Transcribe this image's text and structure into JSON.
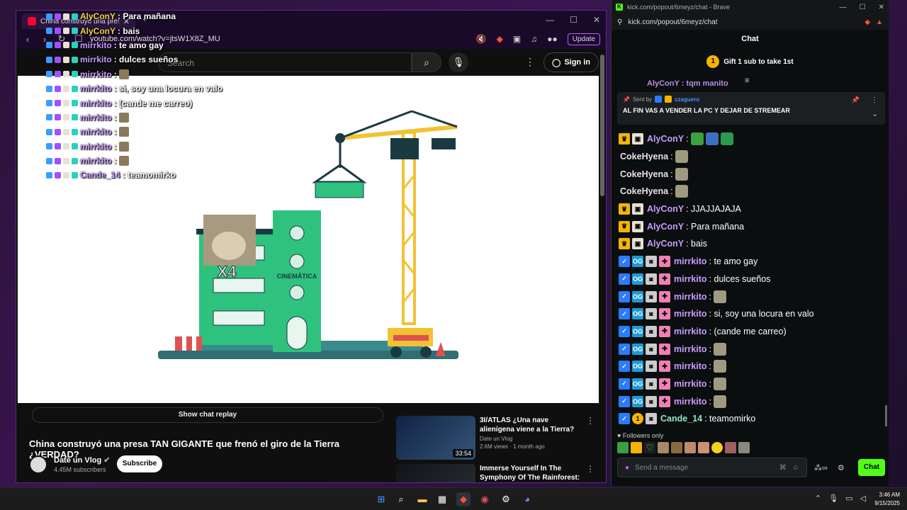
{
  "yt_browser": {
    "tab_title": "China construyó una presa T...",
    "url": "youtube.com/watch?v=jtsW1X8Z_MU",
    "update_label": "Update",
    "search_placeholder": "Search",
    "signin_label": "Sign in"
  },
  "overlay_chat": [
    {
      "user": "AlyConY",
      "text": ": Para mañana",
      "color": "#f5d44a"
    },
    {
      "user": "AlyConY",
      "text": ": bais",
      "color": "#f5d44a"
    },
    {
      "user": "mirrkito",
      "text": ": te amo gay",
      "color": "#ffffff"
    },
    {
      "user": "mirrkito",
      "text": ": dulces sueños",
      "color": "#ffffff"
    },
    {
      "user": "mirrkito",
      "text": ":",
      "color": "#ffffff"
    },
    {
      "user": "mirrkito",
      "text": ": si, soy una locura en valo",
      "color": "#ffffff"
    },
    {
      "user": "mirrkito",
      "text": ": (cande me carreo)",
      "color": "#ffffff"
    },
    {
      "user": "mirrkito",
      "text": ":",
      "color": "#ffffff"
    },
    {
      "user": "mirrkito",
      "text": ":",
      "color": "#ffffff"
    },
    {
      "user": "mirrkito",
      "text": ":",
      "color": "#ffffff"
    },
    {
      "user": "mirrkito",
      "text": ":",
      "color": "#ffffff"
    },
    {
      "user": "Cande_14",
      "text": ": teamomirko",
      "color": "#ffffff"
    }
  ],
  "video": {
    "building_label": "CINEMÁTICA",
    "overlay_label": "X4",
    "replay_label": "Show chat replay",
    "title": "China construyó una presa TAN GIGANTE que frenó el giro de la Tierra ¿VERDAD?",
    "channel": "Date un Vlog",
    "subscribers": "4.45M subscribers",
    "subscribe_label": "Subscribe"
  },
  "recommendations": [
    {
      "title": "3I/ATLAS ¿Una nave alienígena viene a la Tierra?",
      "channel": "Date un Vlog",
      "meta": "2.6M views · 1 month ago",
      "duration": "33:54"
    },
    {
      "title": "Immerse Yourself In The Symphony Of The Rainforest: ...",
      "channel": "",
      "meta": "",
      "duration": ""
    }
  ],
  "kick_browser": {
    "window_title": "kick.com/popout/6meyz/chat - Brave",
    "url": "kick.com/popout/6meyz/chat",
    "header": "Chat",
    "gift_label": "Gift 1 sub to take 1st",
    "gift_count": "1",
    "partial_line": "AlyConY : tqm manito"
  },
  "pinned": {
    "sent_by": "Sent by",
    "user": "czaguero",
    "message": "AL FIN VAS A VENDER LA PC Y DEJAR DE STREMEAR"
  },
  "chat": [
    {
      "user": "AlyConY",
      "color": "#c99cff",
      "text": ":",
      "badges": [
        "crown",
        "sub"
      ],
      "emotes": 3
    },
    {
      "user": "CokeHyena",
      "color": "#e8e0e8",
      "text": ":",
      "badges": [],
      "emotes": 1
    },
    {
      "user": "CokeHyena",
      "color": "#e8e0e8",
      "text": ":",
      "badges": [],
      "emotes": 1
    },
    {
      "user": "CokeHyena",
      "color": "#e8e0e8",
      "text": ":",
      "badges": [],
      "emotes": 1
    },
    {
      "user": "AlyConY",
      "color": "#c99cff",
      "text": ": JJAJJAJAJA",
      "badges": [
        "crown",
        "sub"
      ],
      "emotes": 0
    },
    {
      "user": "AlyConY",
      "color": "#c99cff",
      "text": ": Para mañana",
      "badges": [
        "crown",
        "sub"
      ],
      "emotes": 0
    },
    {
      "user": "AlyConY",
      "color": "#c99cff",
      "text": ": bais",
      "badges": [
        "crown",
        "sub"
      ],
      "emotes": 0
    },
    {
      "user": "mirrkito",
      "color": "#c99cff",
      "text": ": te amo gay",
      "badges": [
        "verified",
        "og",
        "cup",
        "gift"
      ],
      "emotes": 0
    },
    {
      "user": "mirrkito",
      "color": "#c99cff",
      "text": ": dulces sueños",
      "badges": [
        "verified",
        "og",
        "cup",
        "gift"
      ],
      "emotes": 0
    },
    {
      "user": "mirrkito",
      "color": "#c99cff",
      "text": ":",
      "badges": [
        "verified",
        "og",
        "cup",
        "gift"
      ],
      "emotes": 1
    },
    {
      "user": "mirrkito",
      "color": "#c99cff",
      "text": ": si, soy una locura en valo",
      "badges": [
        "verified",
        "og",
        "cup",
        "gift"
      ],
      "emotes": 0
    },
    {
      "user": "mirrkito",
      "color": "#c99cff",
      "text": ": (cande me carreo)",
      "badges": [
        "verified",
        "og",
        "cup",
        "gift"
      ],
      "emotes": 0
    },
    {
      "user": "mirrkito",
      "color": "#c99cff",
      "text": ":",
      "badges": [
        "verified",
        "og",
        "cup",
        "gift"
      ],
      "emotes": 1
    },
    {
      "user": "mirrkito",
      "color": "#c99cff",
      "text": ":",
      "badges": [
        "verified",
        "og",
        "cup",
        "gift"
      ],
      "emotes": 1
    },
    {
      "user": "mirrkito",
      "color": "#c99cff",
      "text": ":",
      "badges": [
        "verified",
        "og",
        "cup",
        "gift"
      ],
      "emotes": 1
    },
    {
      "user": "mirrkito",
      "color": "#c99cff",
      "text": ":",
      "badges": [
        "verified",
        "og",
        "cup",
        "gift"
      ],
      "emotes": 1
    },
    {
      "user": "Cande_14",
      "color": "#8fe6c4",
      "text": ": teamomirko",
      "badges": [
        "verified",
        "coin",
        "cup"
      ],
      "emotes": 0
    }
  ],
  "chat_footer": {
    "followers_only": "Followers only",
    "send_placeholder": "Send a message",
    "chat_button": "Chat"
  },
  "taskbar": {
    "time": "3:46 AM",
    "date": "9/15/2025"
  }
}
